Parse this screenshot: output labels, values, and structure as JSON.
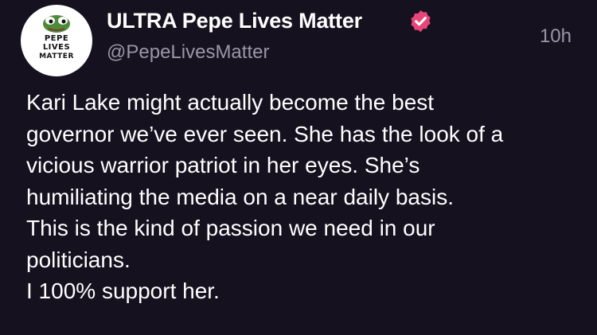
{
  "author": {
    "display_name": "ULTRA Pepe Lives Matter",
    "handle": "@PepeLivesMatter",
    "avatar_text": [
      "PEPE",
      "LIVES",
      "MATTER"
    ],
    "verified_icon": "verified-badge-icon"
  },
  "post": {
    "timestamp": "10h",
    "lines": [
      "Kari Lake might actually become the best",
      "governor we’ve ever seen. She has the look of a",
      "vicious warrior patriot in her eyes. She’s",
      "humiliating the media on a near daily basis.",
      "This is the kind of passion we need in our",
      "politicians.",
      "I 100% support her."
    ]
  },
  "colors": {
    "background": "#15111f",
    "text": "#ffffff",
    "muted": "#9a97a8",
    "badge": "#e8457a"
  }
}
